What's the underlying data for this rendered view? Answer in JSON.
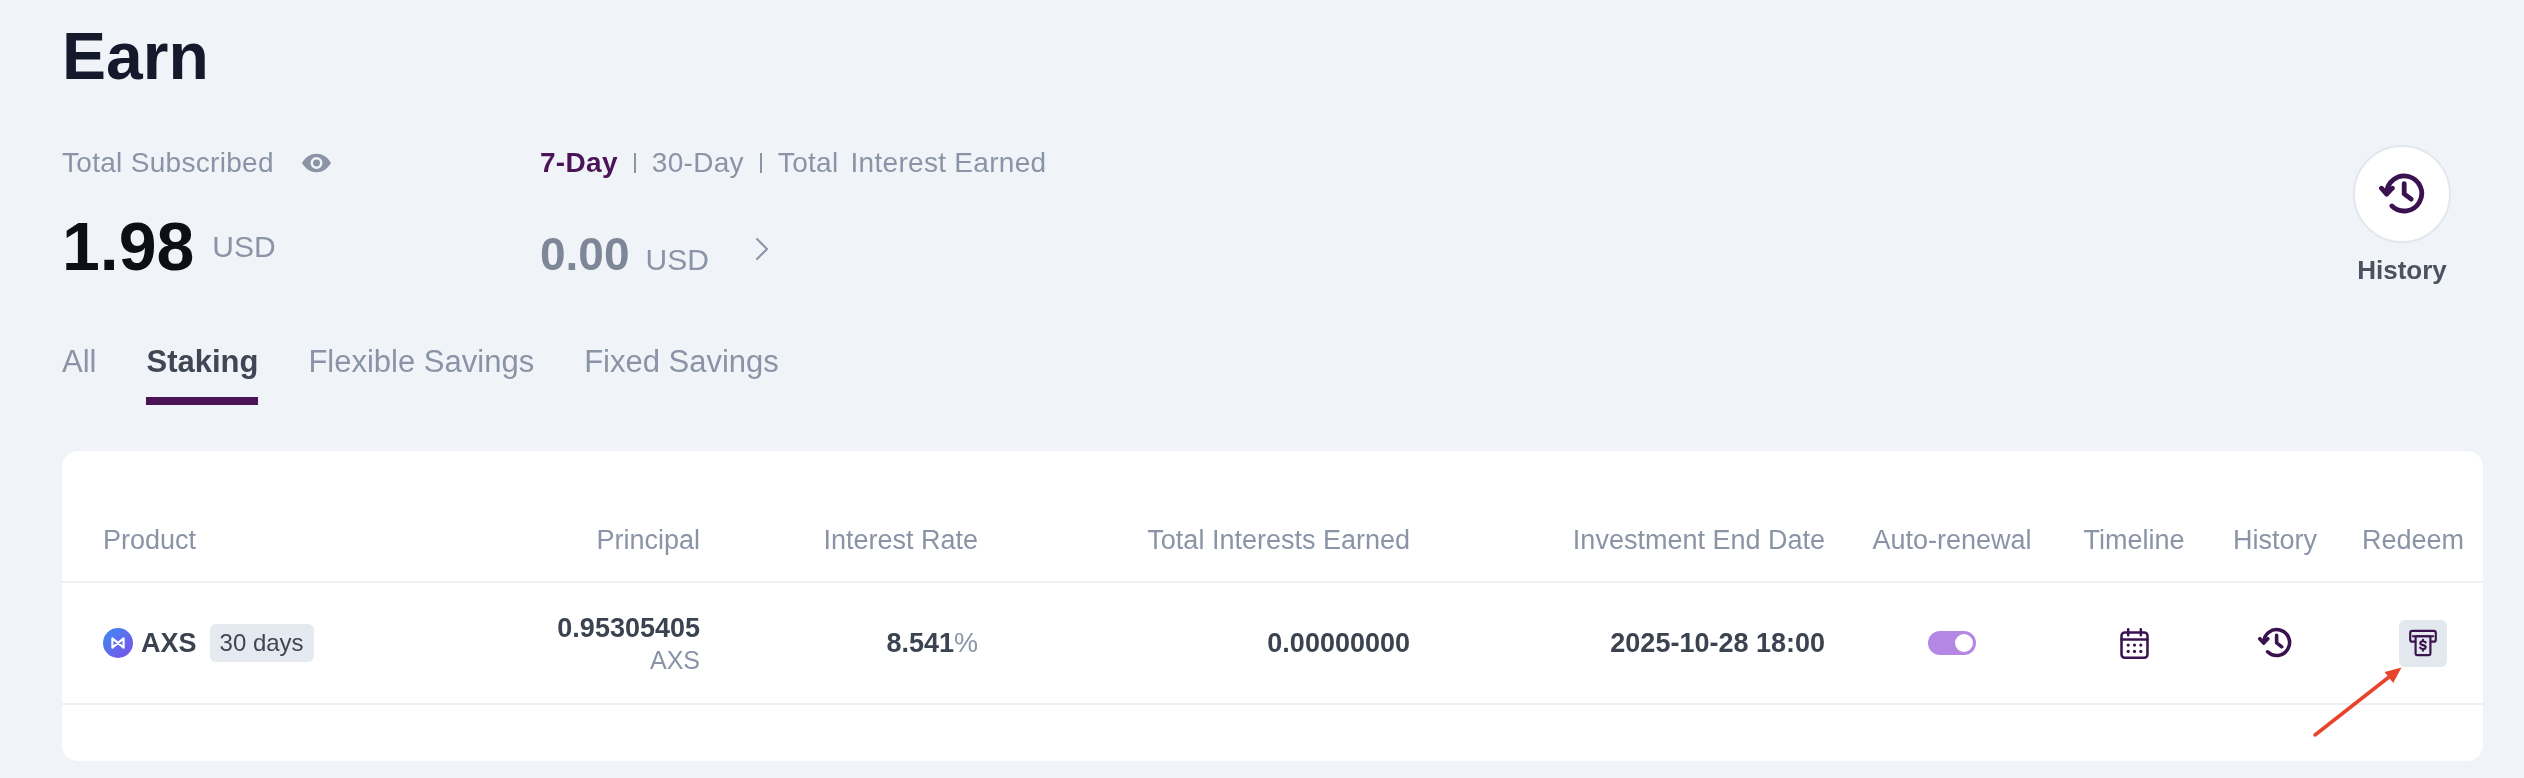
{
  "page": {
    "title": "Earn"
  },
  "summary": {
    "total_subscribed": {
      "label": "Total Subscribed",
      "amount": "1.98",
      "currency": "USD"
    },
    "interest": {
      "periods": [
        {
          "label": "7-Day",
          "selected": true
        },
        {
          "label": "30-Day",
          "selected": false
        },
        {
          "label": "Total",
          "selected": false
        }
      ],
      "label": "Interest Earned",
      "amount": "0.00",
      "currency": "USD"
    }
  },
  "history_button": {
    "label": "History"
  },
  "tabs": [
    {
      "label": "All",
      "selected": false
    },
    {
      "label": "Staking",
      "selected": true
    },
    {
      "label": "Flexible Savings",
      "selected": false
    },
    {
      "label": "Fixed Savings",
      "selected": false
    }
  ],
  "table": {
    "columns": [
      "Product",
      "Principal",
      "Interest Rate",
      "Total Interests Earned",
      "Investment End Date",
      "Auto-renewal",
      "Timeline",
      "History",
      "Redeem"
    ],
    "rows": [
      {
        "product": "AXS",
        "term": "30 days",
        "principal": "0.95305405",
        "principal_unit": "AXS",
        "interest_rate": "**8.541**%",
        "total_interest": "0.00000000",
        "end_date": "2025-10-28 18:00",
        "auto_renewal": true
      }
    ]
  },
  "annotations": [
    {
      "kind": "arrow"
    }
  ]
}
